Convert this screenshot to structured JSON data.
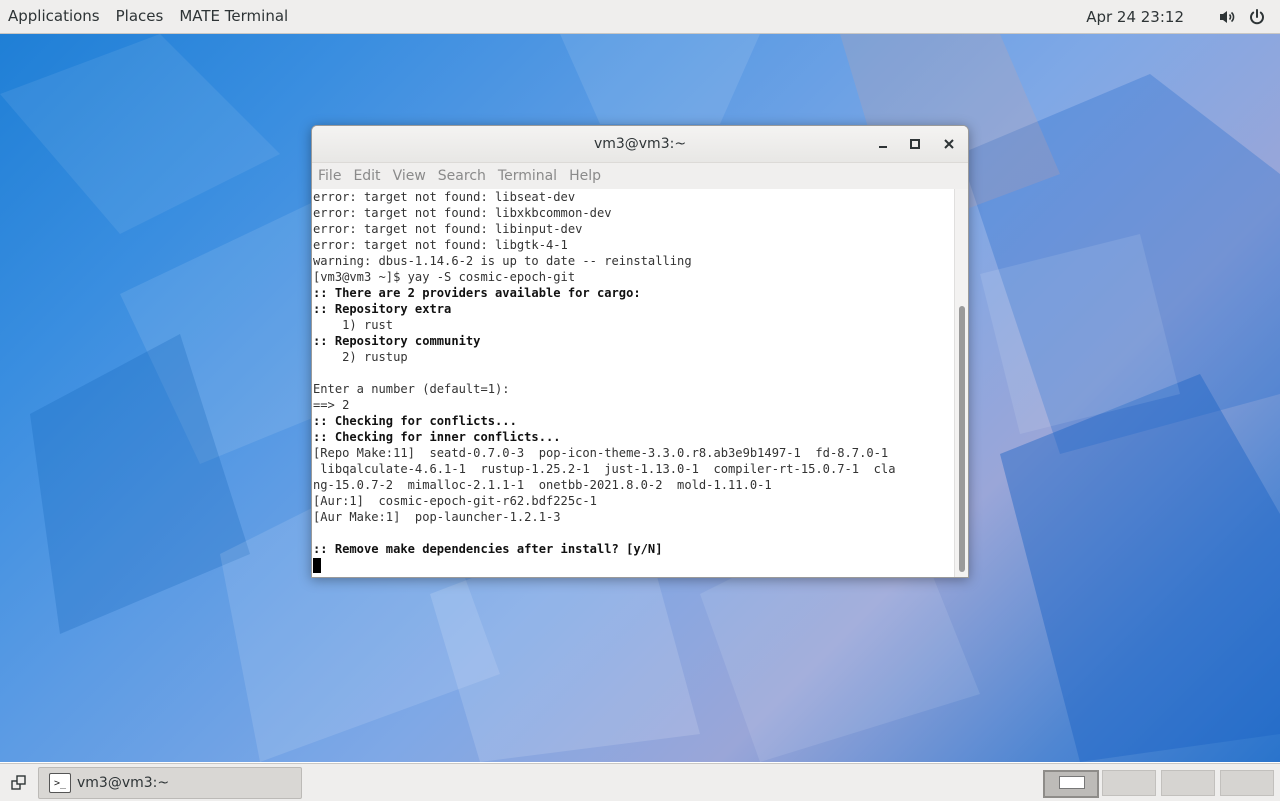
{
  "top_panel": {
    "menu": [
      "Applications",
      "Places",
      "MATE Terminal"
    ],
    "clock": "Apr 24  23:12",
    "tray_icons": [
      "volume-icon",
      "power-icon"
    ]
  },
  "window": {
    "title": "vm3@vm3:~",
    "menu": [
      "File",
      "Edit",
      "View",
      "Search",
      "Terminal",
      "Help"
    ],
    "lines": [
      {
        "text": "error: target not found: libseat-dev",
        "bold": false
      },
      {
        "text": "error: target not found: libxkbcommon-dev",
        "bold": false
      },
      {
        "text": "error: target not found: libinput-dev",
        "bold": false
      },
      {
        "text": "error: target not found: libgtk-4-1",
        "bold": false
      },
      {
        "text": "warning: dbus-1.14.6-2 is up to date -- reinstalling",
        "bold": false
      },
      {
        "text": "[vm3@vm3 ~]$ yay -S cosmic-epoch-git",
        "bold": false
      },
      {
        "text": ":: There are 2 providers available for cargo:",
        "bold": true
      },
      {
        "text": ":: Repository extra",
        "bold": true
      },
      {
        "text": "    1) rust",
        "bold": false
      },
      {
        "text": ":: Repository community",
        "bold": true
      },
      {
        "text": "    2) rustup",
        "bold": false
      },
      {
        "text": "",
        "bold": false
      },
      {
        "text": "Enter a number (default=1):",
        "bold": false
      },
      {
        "text": "==> 2",
        "bold": false
      },
      {
        "text": ":: Checking for conflicts...",
        "bold": true
      },
      {
        "text": ":: Checking for inner conflicts...",
        "bold": true
      },
      {
        "text": "[Repo Make:11]  seatd-0.7.0-3  pop-icon-theme-3.3.0.r8.ab3e9b1497-1  fd-8.7.0-1",
        "bold": false
      },
      {
        "text": " libqalculate-4.6.1-1  rustup-1.25.2-1  just-1.13.0-1  compiler-rt-15.0.7-1  cla",
        "bold": false
      },
      {
        "text": "ng-15.0.7-2  mimalloc-2.1.1-1  onetbb-2021.8.0-2  mold-1.11.0-1",
        "bold": false
      },
      {
        "text": "[Aur:1]  cosmic-epoch-git-r62.bdf225c-1",
        "bold": false
      },
      {
        "text": "[Aur Make:1]  pop-launcher-1.2.1-3",
        "bold": false
      },
      {
        "text": "",
        "bold": false
      },
      {
        "text": ":: Remove make dependencies after install? [y/N]",
        "bold": true
      }
    ]
  },
  "bottom_panel": {
    "task_label": "vm3@vm3:~",
    "task_icon_glyph": ">_",
    "workspaces": 4,
    "active_workspace": 1
  }
}
